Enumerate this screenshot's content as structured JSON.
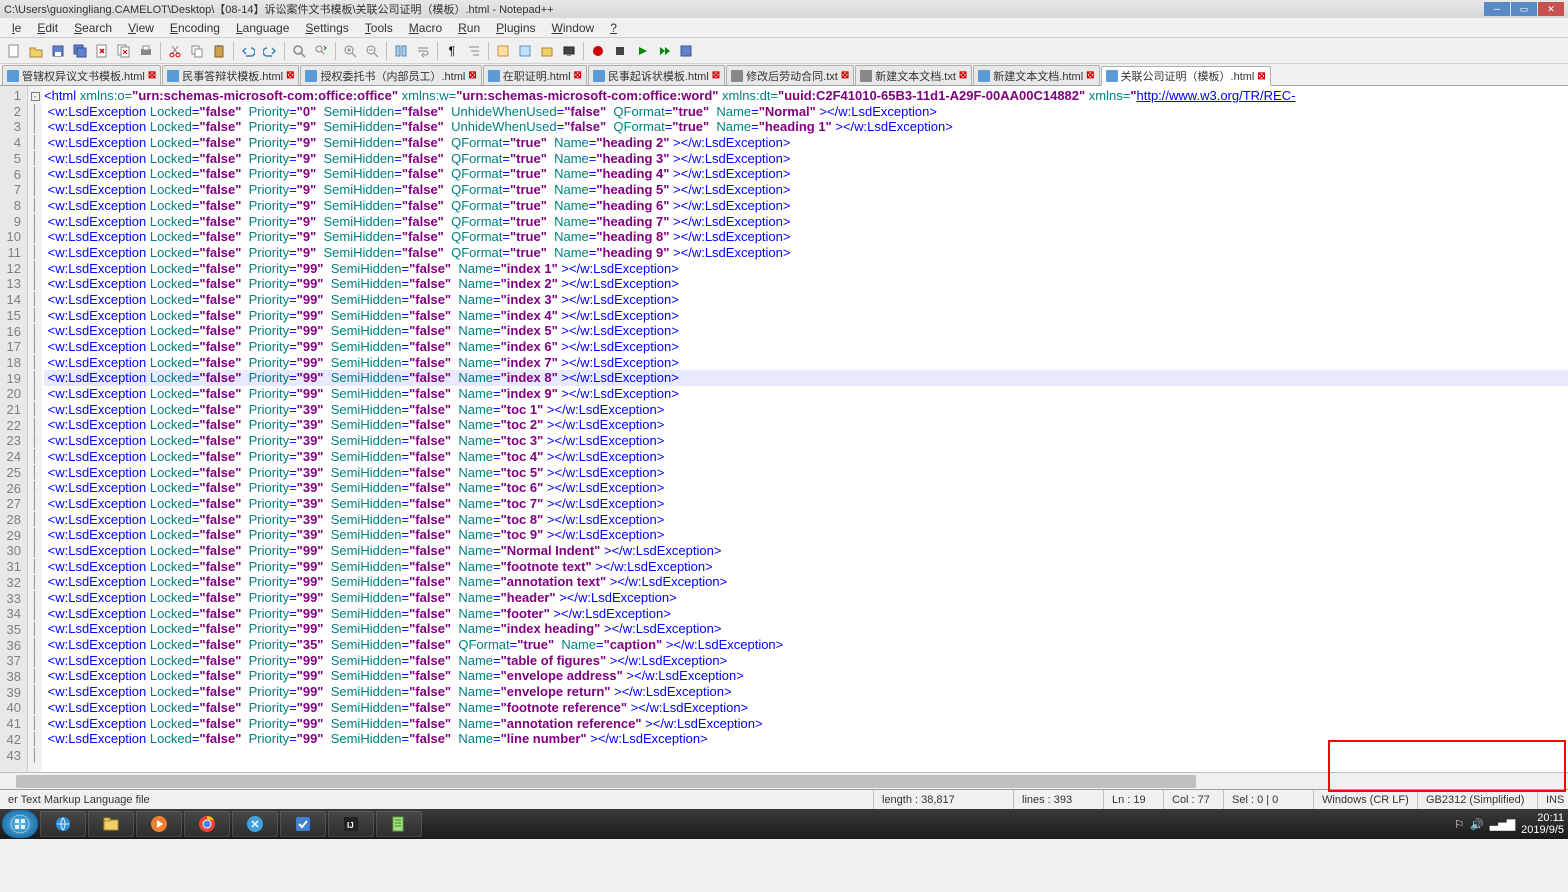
{
  "window": {
    "title": "C:\\Users\\guoxingliang.CAMELOT\\Desktop\\【08-14】诉讼案件文书模板\\关联公司证明（模板）.html - Notepad++"
  },
  "menus": [
    "le",
    "Edit",
    "Search",
    "View",
    "Encoding",
    "Language",
    "Settings",
    "Tools",
    "Macro",
    "Run",
    "Plugins",
    "Window",
    "?"
  ],
  "tabs": [
    {
      "label": "管辖权异议文书模板.html",
      "icon": "html",
      "close": true
    },
    {
      "label": "民事答辩状模板.html",
      "icon": "html",
      "close": true
    },
    {
      "label": "授权委托书（内部员工）.html",
      "icon": "html",
      "close": true
    },
    {
      "label": "在职证明.html",
      "icon": "html",
      "close": true
    },
    {
      "label": "民事起诉状模板.html",
      "icon": "html",
      "close": true
    },
    {
      "label": "修改后劳动合同.txt",
      "icon": "txt",
      "close": true
    },
    {
      "label": "新建文本文档.txt",
      "icon": "txt",
      "close": true
    },
    {
      "label": "新建文本文档.html",
      "icon": "html",
      "close": true
    },
    {
      "label": "关联公司证明（模板）.html",
      "icon": "html",
      "close": true,
      "active": true
    }
  ],
  "code": {
    "line1_parts": {
      "open": "<html",
      "attr1": " xmlns:o=",
      "val1": "\"urn:schemas-microsoft-com:office:office\"",
      "attr2": " xmlns:w=",
      "val2": "\"urn:schemas-microsoft-com:office:word\"",
      "attr3": " xmlns:dt=",
      "val3": "\"uuid:C2F41010-65B3-11d1-A29F-00AA00C14882\"",
      "attr4": " xmlns=",
      "val4": "\"http://www.w3.org/TR/REC-"
    },
    "lines": [
      {
        "n": 2,
        "pri": "0",
        "extra": "  UnhideWhenUsed=\"false\"  QFormat=\"true\"  Name=\"Normal\" ></w:LsdException>"
      },
      {
        "n": 3,
        "pri": "9",
        "extra": "  UnhideWhenUsed=\"false\"  QFormat=\"true\"  Name=\"heading 1\" ></w:LsdException>"
      },
      {
        "n": 4,
        "pri": "9",
        "extra": "  QFormat=\"true\"  Name=\"heading 2\" ></w:LsdException>"
      },
      {
        "n": 5,
        "pri": "9",
        "extra": "  QFormat=\"true\"  Name=\"heading 3\" ></w:LsdException>"
      },
      {
        "n": 6,
        "pri": "9",
        "extra": "  QFormat=\"true\"  Name=\"heading 4\" ></w:LsdException>"
      },
      {
        "n": 7,
        "pri": "9",
        "extra": "  QFormat=\"true\"  Name=\"heading 5\" ></w:LsdException>"
      },
      {
        "n": 8,
        "pri": "9",
        "extra": "  QFormat=\"true\"  Name=\"heading 6\" ></w:LsdException>"
      },
      {
        "n": 9,
        "pri": "9",
        "extra": "  QFormat=\"true\"  Name=\"heading 7\" ></w:LsdException>"
      },
      {
        "n": 10,
        "pri": "9",
        "extra": "  QFormat=\"true\"  Name=\"heading 8\" ></w:LsdException>"
      },
      {
        "n": 11,
        "pri": "9",
        "extra": "  QFormat=\"true\"  Name=\"heading 9\" ></w:LsdException>"
      },
      {
        "n": 12,
        "pri": "99",
        "extra": "  Name=\"index 1\" ></w:LsdException>"
      },
      {
        "n": 13,
        "pri": "99",
        "extra": "  Name=\"index 2\" ></w:LsdException>"
      },
      {
        "n": 14,
        "pri": "99",
        "extra": "  Name=\"index 3\" ></w:LsdException>"
      },
      {
        "n": 15,
        "pri": "99",
        "extra": "  Name=\"index 4\" ></w:LsdException>"
      },
      {
        "n": 16,
        "pri": "99",
        "extra": "  Name=\"index 5\" ></w:LsdException>"
      },
      {
        "n": 17,
        "pri": "99",
        "extra": "  Name=\"index 6\" ></w:LsdException>"
      },
      {
        "n": 18,
        "pri": "99",
        "extra": "  Name=\"index 7\" ></w:LsdException>"
      },
      {
        "n": 19,
        "pri": "99",
        "extra": "  Name=\"index 8\" ></w:LsdException>",
        "hl": true
      },
      {
        "n": 20,
        "pri": "99",
        "extra": "  Name=\"index 9\" ></w:LsdException>"
      },
      {
        "n": 21,
        "pri": "39",
        "extra": "  Name=\"toc 1\" ></w:LsdException>"
      },
      {
        "n": 22,
        "pri": "39",
        "extra": "  Name=\"toc 2\" ></w:LsdException>"
      },
      {
        "n": 23,
        "pri": "39",
        "extra": "  Name=\"toc 3\" ></w:LsdException>"
      },
      {
        "n": 24,
        "pri": "39",
        "extra": "  Name=\"toc 4\" ></w:LsdException>"
      },
      {
        "n": 25,
        "pri": "39",
        "extra": "  Name=\"toc 5\" ></w:LsdException>"
      },
      {
        "n": 26,
        "pri": "39",
        "extra": "  Name=\"toc 6\" ></w:LsdException>"
      },
      {
        "n": 27,
        "pri": "39",
        "extra": "  Name=\"toc 7\" ></w:LsdException>"
      },
      {
        "n": 28,
        "pri": "39",
        "extra": "  Name=\"toc 8\" ></w:LsdException>"
      },
      {
        "n": 29,
        "pri": "39",
        "extra": "  Name=\"toc 9\" ></w:LsdException>"
      },
      {
        "n": 30,
        "pri": "99",
        "extra": "  Name=\"Normal Indent\" ></w:LsdException>"
      },
      {
        "n": 31,
        "pri": "99",
        "extra": "  Name=\"footnote text\" ></w:LsdException>"
      },
      {
        "n": 32,
        "pri": "99",
        "extra": "  Name=\"annotation text\" ></w:LsdException>"
      },
      {
        "n": 33,
        "pri": "99",
        "extra": "  Name=\"header\" ></w:LsdException>"
      },
      {
        "n": 34,
        "pri": "99",
        "extra": "  Name=\"footer\" ></w:LsdException>"
      },
      {
        "n": 35,
        "pri": "99",
        "extra": "  Name=\"index heading\" ></w:LsdException>"
      },
      {
        "n": 36,
        "pri": "35",
        "extra": "  QFormat=\"true\"  Name=\"caption\" ></w:LsdException>"
      },
      {
        "n": 37,
        "pri": "99",
        "extra": "  Name=\"table of figures\" ></w:LsdException>"
      },
      {
        "n": 38,
        "pri": "99",
        "extra": "  Name=\"envelope address\" ></w:LsdException>"
      },
      {
        "n": 39,
        "pri": "99",
        "extra": "  Name=\"envelope return\" ></w:LsdException>"
      },
      {
        "n": 40,
        "pri": "99",
        "extra": "  Name=\"footnote reference\" ></w:LsdException>"
      },
      {
        "n": 41,
        "pri": "99",
        "extra": "  Name=\"annotation reference\" ></w:LsdException>"
      },
      {
        "n": 42,
        "pri": "99",
        "extra": "  Name=\"line number\" ></w:LsdException>"
      }
    ]
  },
  "status": {
    "type": "er Text Markup Language file",
    "length": "length : 38,817",
    "lines": "lines : 393",
    "ln": "Ln : 19",
    "col": "Col : 77",
    "sel": "Sel : 0 | 0",
    "eol": "Windows (CR LF)",
    "enc": "GB2312 (Simplified)",
    "ins": "INS"
  },
  "tray": {
    "time": "20:11",
    "date": "2019/9/5"
  }
}
